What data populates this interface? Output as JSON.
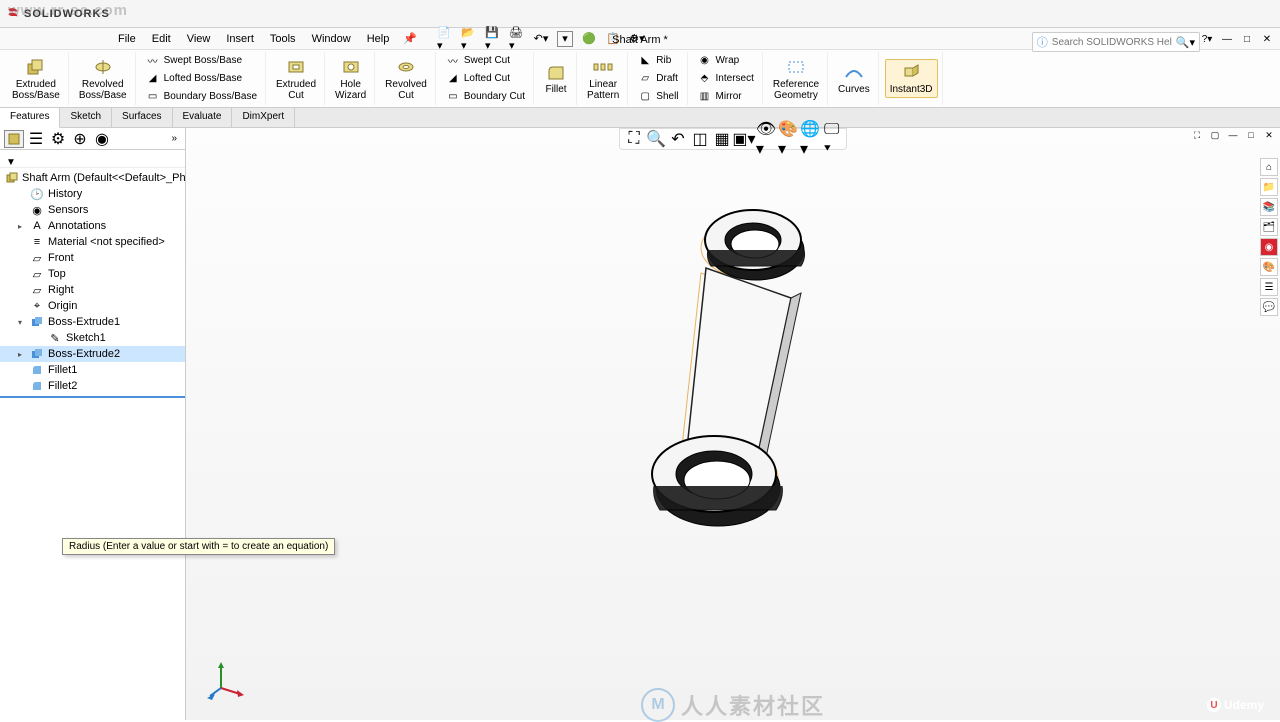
{
  "watermark_url": "www.rr-sc.com",
  "app_name": "SOLIDWORKS",
  "menubar": [
    "File",
    "Edit",
    "View",
    "Insert",
    "Tools",
    "Window",
    "Help"
  ],
  "document_title": "Shaft Arm *",
  "search_placeholder": "Search SOLIDWORKS Help",
  "ribbon_tabs": [
    "Features",
    "Sketch",
    "Surfaces",
    "Evaluate",
    "DimXpert"
  ],
  "ribbon": {
    "extruded_boss": "Extruded\nBoss/Base",
    "revolved_boss": "Revolved\nBoss/Base",
    "swept_boss": "Swept Boss/Base",
    "lofted_boss": "Lofted Boss/Base",
    "boundary_boss": "Boundary Boss/Base",
    "extruded_cut": "Extruded\nCut",
    "hole_wizard": "Hole\nWizard",
    "revolved_cut": "Revolved\nCut",
    "swept_cut": "Swept Cut",
    "lofted_cut": "Lofted Cut",
    "boundary_cut": "Boundary Cut",
    "fillet": "Fillet",
    "linear_pattern": "Linear\nPattern",
    "rib": "Rib",
    "draft": "Draft",
    "shell": "Shell",
    "wrap": "Wrap",
    "intersect": "Intersect",
    "mirror": "Mirror",
    "ref_geom": "Reference\nGeometry",
    "curves": "Curves",
    "instant3d": "Instant3D"
  },
  "tree": {
    "root": "Shaft Arm  (Default<<Default>_PhotoWorks Dis",
    "items": [
      {
        "label": "History",
        "icon": "history"
      },
      {
        "label": "Sensors",
        "icon": "sensor"
      },
      {
        "label": "Annotations",
        "icon": "annotation",
        "expandable": true
      },
      {
        "label": "Material <not specified>",
        "icon": "material"
      },
      {
        "label": "Front",
        "icon": "plane"
      },
      {
        "label": "Top",
        "icon": "plane"
      },
      {
        "label": "Right",
        "icon": "plane"
      },
      {
        "label": "Origin",
        "icon": "origin"
      },
      {
        "label": "Boss-Extrude1",
        "icon": "extrude",
        "expandable": true,
        "expanded": true,
        "children": [
          {
            "label": "Sketch1",
            "icon": "sketch"
          }
        ]
      },
      {
        "label": "Boss-Extrude2",
        "icon": "extrude",
        "expandable": true,
        "selected": true
      },
      {
        "label": "Fillet1",
        "icon": "fillet"
      },
      {
        "label": "Fillet2",
        "icon": "fillet"
      }
    ]
  },
  "tooltip": "Radius (Enter a value or start with = to create an equation)",
  "center_watermark": "人人素材社区",
  "udemy": "Udemy"
}
